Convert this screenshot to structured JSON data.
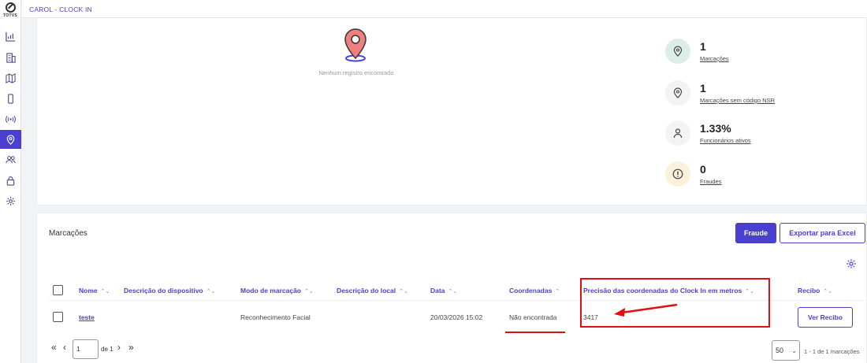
{
  "header": {
    "title": "CAROL - CLOCK IN"
  },
  "sidebar": {
    "logo_text": "TOTVS",
    "items": [
      {
        "icon": "chart-icon",
        "label": ""
      },
      {
        "icon": "building-icon",
        "label": ""
      },
      {
        "icon": "map-icon",
        "label": ""
      },
      {
        "icon": "mobile-icon",
        "label": ""
      },
      {
        "icon": "signal-icon",
        "label": ""
      },
      {
        "icon": "location-pin-icon",
        "label": "",
        "active": true
      },
      {
        "icon": "users-icon",
        "label": ""
      },
      {
        "icon": "lock-icon",
        "label": ""
      },
      {
        "icon": "gear-icon",
        "label": ""
      }
    ]
  },
  "map_panel": {
    "empty_text": "Nenhum registro encontrado"
  },
  "stats": [
    {
      "value": "1",
      "label": "Marcações",
      "icon": "location-pin-icon"
    },
    {
      "value": "1",
      "label": "Marcações sem código NSR",
      "icon": "location-pin-icon"
    },
    {
      "value": "1.33%",
      "label": "Funcionários ativos",
      "icon": "person-icon"
    },
    {
      "value": "0",
      "label": "Fraudes",
      "icon": "alert-icon"
    }
  ],
  "table_section": {
    "title": "Marcações",
    "fraude_button": "Fraude",
    "export_button": "Exportar para Excel",
    "columns": [
      "Nome",
      "Descrição do dispositivo",
      "Modo de marcação",
      "Descrição do local",
      "Data",
      "Coordenadas",
      "Precisão das coordenadas do Clock In em metros",
      "Recibo"
    ],
    "rows": [
      {
        "nome": "teste",
        "dispositivo": "",
        "modo": "Reconhecimento Facial",
        "local": "",
        "data": "20/03/2026 15:02",
        "coordenadas": "Não encontrada",
        "precisao": "3417",
        "recibo_button": "Ver Recibo"
      }
    ]
  },
  "pagination": {
    "page": "1",
    "of_label": "de 1",
    "per_page": "50",
    "range_text": "1 - 1 de 1 marcações"
  },
  "colors": {
    "accent": "#4b3fcf",
    "annotation": "#e01010"
  }
}
